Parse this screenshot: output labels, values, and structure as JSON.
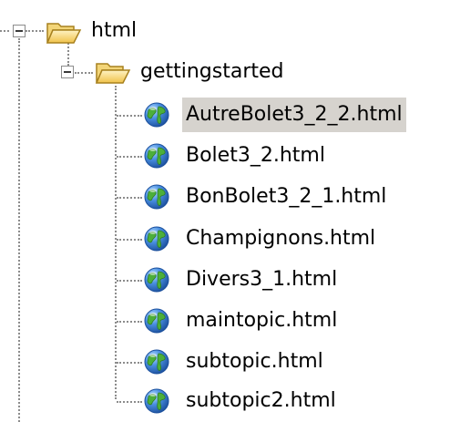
{
  "tree": {
    "root": {
      "label": "html",
      "icon": "folder-open-icon",
      "expanded": true
    },
    "child": {
      "label": "gettingstarted",
      "icon": "folder-open-icon",
      "expanded": true
    },
    "files": [
      {
        "label": "AutreBolet3_2_2.html",
        "icon": "web-page-globe-icon",
        "selected": true
      },
      {
        "label": "Bolet3_2.html",
        "icon": "web-page-globe-icon",
        "selected": false
      },
      {
        "label": "BonBolet3_2_1.html",
        "icon": "web-page-globe-icon",
        "selected": false
      },
      {
        "label": "Champignons.html",
        "icon": "web-page-globe-icon",
        "selected": false
      },
      {
        "label": "Divers3_1.html",
        "icon": "web-page-globe-icon",
        "selected": false
      },
      {
        "label": "maintopic.html",
        "icon": "web-page-globe-icon",
        "selected": false
      },
      {
        "label": "subtopic.html",
        "icon": "web-page-globe-icon",
        "selected": false
      },
      {
        "label": "subtopic2.html",
        "icon": "web-page-globe-icon",
        "selected": false
      }
    ]
  },
  "colors": {
    "selection": "#d6d3ce",
    "connector": "#8c8c8c",
    "folder": "#f2c84b",
    "globe_water": "#2f72c8",
    "globe_land": "#4caf3a"
  }
}
